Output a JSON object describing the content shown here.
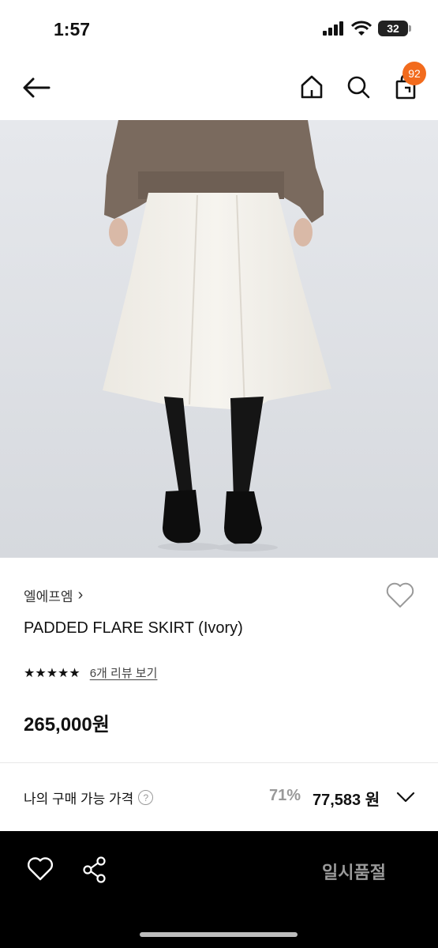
{
  "status_bar": {
    "time": "1:57",
    "battery": "32",
    "icons": [
      "signal-icon",
      "wifi-icon",
      "battery-icon"
    ]
  },
  "header": {
    "icons": [
      "back-arrow-icon",
      "home-icon",
      "search-icon",
      "cart-icon"
    ],
    "cart_badge": "92"
  },
  "product": {
    "brand": "엘에프엠",
    "brand_chevron": "›",
    "name": "PADDED FLARE SKIRT (Ivory)",
    "stars": "★★★★★",
    "rating": 5,
    "review_link": "6개 리뷰 보기",
    "price": "265,000원"
  },
  "my_price": {
    "label": "나의 구매 가능 가격",
    "help": "?",
    "discount_pct": "71%",
    "discount_price": "77,583 원"
  },
  "bottom_bar": {
    "soldout_label": "일시품절",
    "icons": [
      "heart-icon",
      "share-icon"
    ]
  },
  "colors": {
    "badge": "#f26b1d",
    "bottom_bar_bg": "#000000",
    "soldout_text": "#9a9a9a"
  }
}
